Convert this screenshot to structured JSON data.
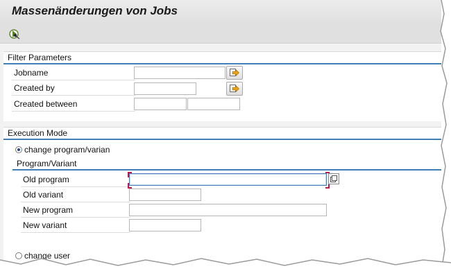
{
  "window": {
    "title": "Massenänderungen von Jobs"
  },
  "toolbar": {
    "execute_icon": "execute-icon"
  },
  "filter": {
    "title": "Filter Parameters",
    "jobname_label": "Jobname",
    "jobname_value": "",
    "created_by_label": "Created by",
    "created_by_value": "",
    "created_between_label": "Created between",
    "created_from_value": "",
    "created_to_value": ""
  },
  "execution": {
    "title": "Execution Mode",
    "option_change_program": "change program/varian",
    "option_change_user": "change user",
    "selected": "change program/varian"
  },
  "program_variant": {
    "title": "Program/Variant",
    "old_program_label": "Old program",
    "old_program_value": "",
    "old_variant_label": "Old variant",
    "old_variant_value": "",
    "new_program_label": "New program",
    "new_program_value": "",
    "new_variant_label": "New variant",
    "new_variant_value": ""
  },
  "colors": {
    "accent_line": "#3f7fb5",
    "focus_marker": "#c4154f",
    "background": "#f2f2f2"
  }
}
